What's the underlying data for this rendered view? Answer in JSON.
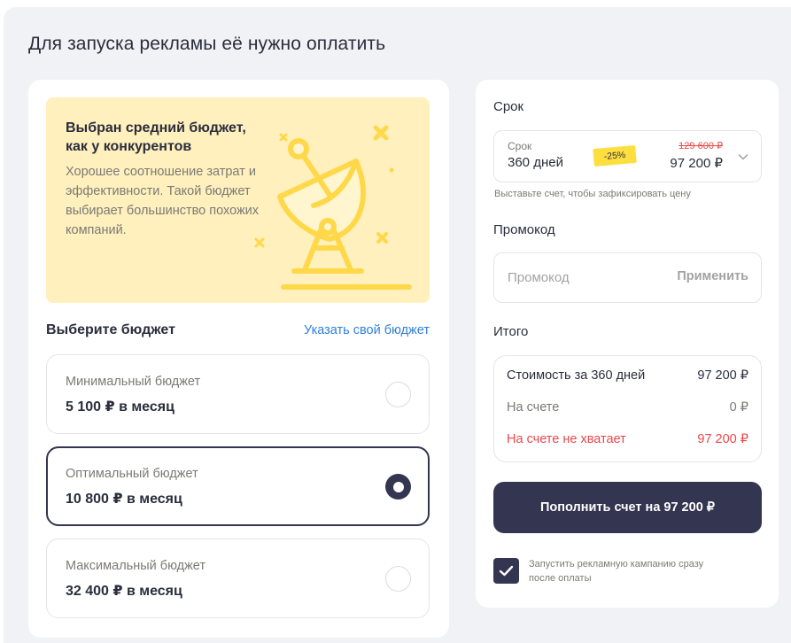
{
  "page": {
    "title": "Для запуска рекламы её нужно оплатить"
  },
  "promo": {
    "title": "Выбран средний бюджет, как у конкурентов",
    "text": "Хорошее соотношение затрат и эффективности. Такой бюджет выбирает большинство похожих компаний.",
    "illustration_icon": "satellite-dish-icon",
    "background_color": "#fff0bd"
  },
  "budget": {
    "title": "Выберите бюджет",
    "custom_link": "Указать свой бюджет",
    "options": [
      {
        "label": "Минимальный бюджет",
        "value": "5 100 ₽ в месяц",
        "selected": false
      },
      {
        "label": "Оптимальный бюджет",
        "value": "10 800 ₽ в месяц",
        "selected": true
      },
      {
        "label": "Максимальный бюджет",
        "value": "32 400 ₽ в месяц",
        "selected": false
      }
    ]
  },
  "term": {
    "section_title": "Срок",
    "label": "Срок",
    "value": "360 дней",
    "discount": "-25%",
    "old_price": "129 600 ₽",
    "new_price": "97 200 ₽",
    "hint": "Выставьте счет, чтобы зафиксировать цену"
  },
  "promocode": {
    "section_title": "Промокод",
    "placeholder": "Промокод",
    "apply_label": "Применить"
  },
  "total": {
    "section_title": "Итого",
    "rows": [
      {
        "label": "Стоимость за 360 дней",
        "value": "97 200 ₽"
      },
      {
        "label": "На счете",
        "value": "0 ₽"
      },
      {
        "label": "На счете не хватает",
        "value": "97 200 ₽"
      }
    ]
  },
  "pay_button": "Пополнить счет на 97 200 ₽",
  "autostart": {
    "checked": true,
    "label": "Запустить рекламную кампанию сразу после оплаты"
  },
  "colors": {
    "accent_dark": "#343550",
    "link": "#2f80d9",
    "error": "#e8474a",
    "discount_badge": "#ffde40"
  }
}
